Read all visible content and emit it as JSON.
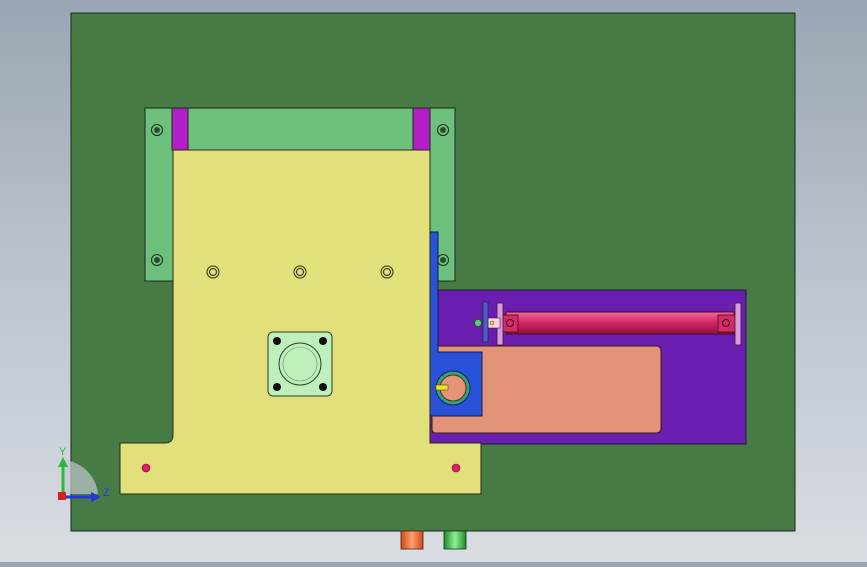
{
  "view": {
    "type": "CAD assembly front view",
    "colors": {
      "base_plate": "#467b45",
      "l_bracket": "#6cc07c",
      "main_plate": "#e2e07a",
      "spacer": "#b21ec8",
      "cylinder_plate": "#6a1eb0",
      "slider_block": "#e39378",
      "cylinder_rod": "#cc1f5c",
      "blue_bracket": "#2a52d8",
      "flange": "#bff0bb"
    }
  },
  "triad": {
    "y_label": "Y",
    "z_label": "Z"
  },
  "bottom_markers": [
    {
      "name": "orange-marker",
      "color": "#e8652a"
    },
    {
      "name": "green-marker",
      "color": "#3ec24a"
    }
  ]
}
